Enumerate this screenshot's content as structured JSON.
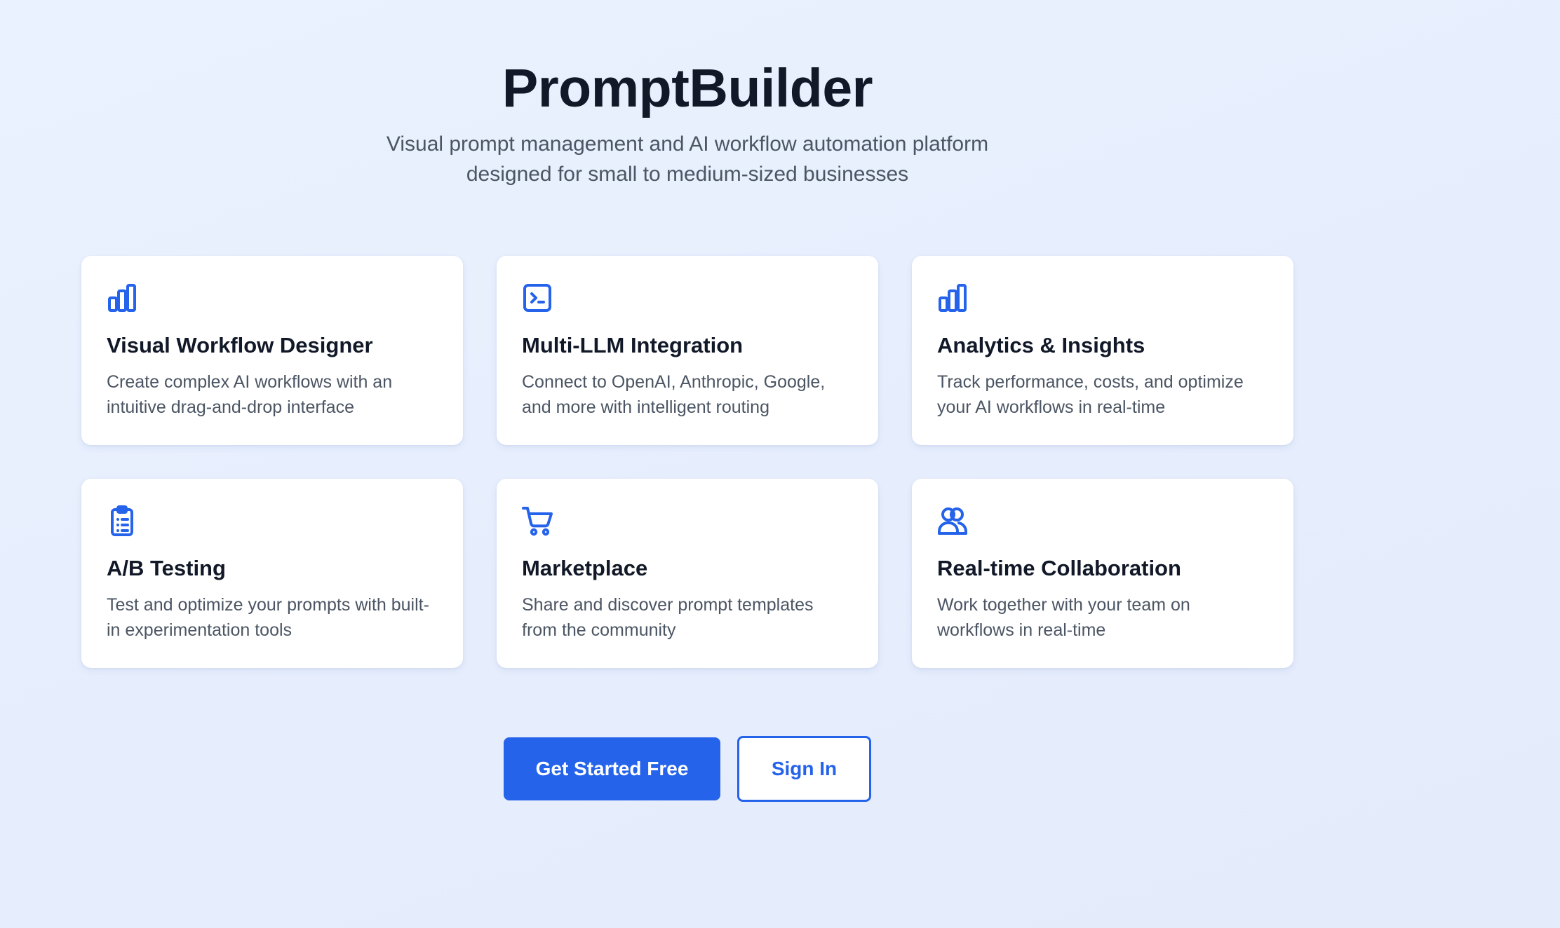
{
  "hero": {
    "title": "PromptBuilder",
    "subtitle_line1": "Visual prompt management and AI workflow automation platform",
    "subtitle_line2": "designed for small to medium-sized businesses"
  },
  "features": [
    {
      "icon": "bar-chart-icon",
      "title": "Visual Workflow Designer",
      "description": "Create complex AI workflows with an intuitive drag-and-drop interface"
    },
    {
      "icon": "terminal-icon",
      "title": "Multi-LLM Integration",
      "description": "Connect to OpenAI, Anthropic, Google, and more with intelligent routing"
    },
    {
      "icon": "bar-chart-icon",
      "title": "Analytics & Insights",
      "description": "Track performance, costs, and optimize your AI workflows in real-time"
    },
    {
      "icon": "clipboard-list-icon",
      "title": "A/B Testing",
      "description": "Test and optimize your prompts with built-in experimentation tools"
    },
    {
      "icon": "shopping-cart-icon",
      "title": "Marketplace",
      "description": "Share and discover prompt templates from the community"
    },
    {
      "icon": "users-icon",
      "title": "Real-time Collaboration",
      "description": "Work together with your team on workflows in real-time"
    }
  ],
  "actions": {
    "primary_label": "Get Started Free",
    "secondary_label": "Sign In"
  },
  "colors": {
    "accent": "#2563eb",
    "heading": "#111827",
    "body_text": "#4b5563",
    "background": "#e8f0fe",
    "card": "#ffffff"
  }
}
